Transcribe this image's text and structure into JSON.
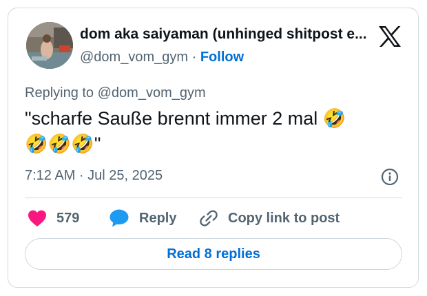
{
  "author": {
    "display_name": "dom aka saiyaman (unhinged shitpost e...",
    "handle": "@dom_vom_gym",
    "separator": "·",
    "follow_label": "Follow"
  },
  "tweet": {
    "replying_to": "Replying to @dom_vom_gym",
    "text_line1": "\"scharfe Sauße brennt immer 2 mal 🤣",
    "text_line2": "🤣🤣🤣\"",
    "timestamp": "7:12 AM · Jul 25, 2025"
  },
  "actions": {
    "like_count": "579",
    "reply_label": "Reply",
    "copy_label": "Copy link to post"
  },
  "read_replies_label": "Read 8 replies",
  "icons": {
    "brand": "x-logo-icon",
    "like": "heart-icon",
    "reply": "speech-bubble-icon",
    "copy": "link-icon",
    "info": "info-icon"
  },
  "colors": {
    "like": "#f91880",
    "reply": "#1d9bf0",
    "link": "#006fd6",
    "muted": "#536471",
    "text": "#0f1419",
    "border": "#cfd9de"
  }
}
